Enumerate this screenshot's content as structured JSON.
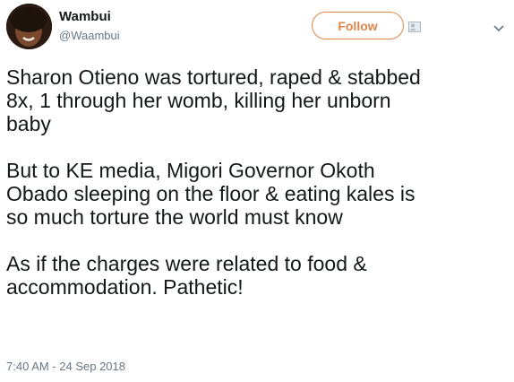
{
  "author": {
    "display_name": "Wambui",
    "handle": "@Waambui"
  },
  "follow_button": {
    "label": "Follow",
    "color": "#e0854a"
  },
  "tweet": {
    "paragraphs": [
      "Sharon Otieno was tortured, raped & stabbed\n8x, 1 through her womb, killing her unborn\nbaby",
      "But to KE media, Migori Governor Okoth\nObado sleeping on the floor & eating kales is\nso much torture the world must know",
      "As if the charges were related to food &\naccommodation. Pathetic!"
    ],
    "timestamp": "7:40 AM - 24 Sep 2018"
  },
  "icons": {
    "avatar": "avatar-photo",
    "follow_icon": "follow-person-icon",
    "menu": "chevron-down-icon"
  },
  "colors": {
    "text": "#14171a",
    "secondary": "#657786"
  }
}
